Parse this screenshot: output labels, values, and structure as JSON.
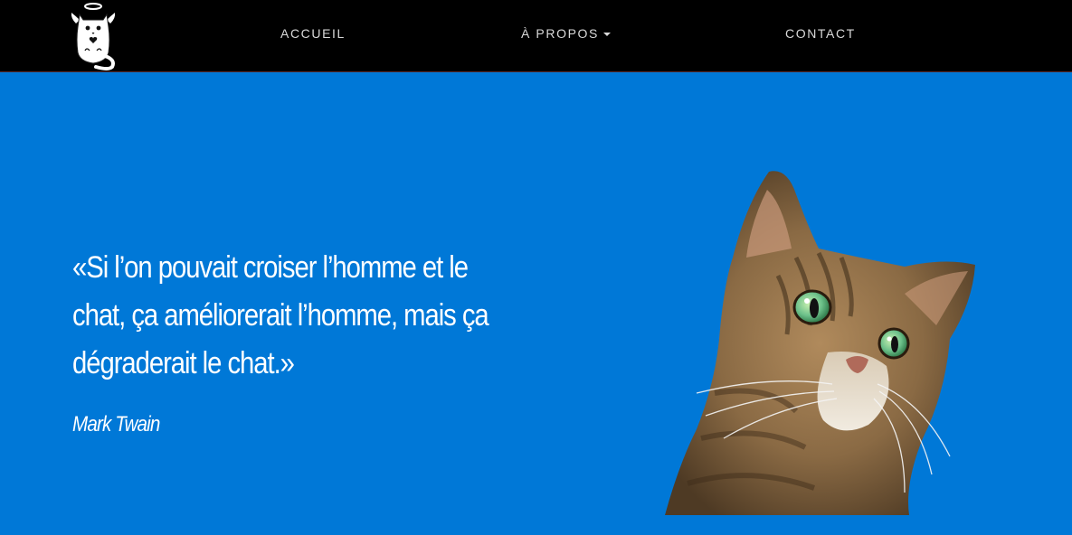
{
  "nav": {
    "items": [
      {
        "label": "ACCUEIL"
      },
      {
        "label": "À PROPOS",
        "has_dropdown": true,
        "icon": "caret-down-icon"
      },
      {
        "label": "CONTACT"
      }
    ],
    "logo_icon": "angel-cat-logo-icon"
  },
  "hero": {
    "quote": "«Si l’on pouvait croiser l’homme et le chat, ça améliorerait l’homme, mais ça dégraderait le chat.»",
    "author": "Mark Twain",
    "image_icon": "tabby-cat-photo"
  },
  "colors": {
    "navbar_bg": "#000000",
    "hero_bg": "#0078d7",
    "text": "#ffffff",
    "nav_text": "#d9d9d9"
  }
}
